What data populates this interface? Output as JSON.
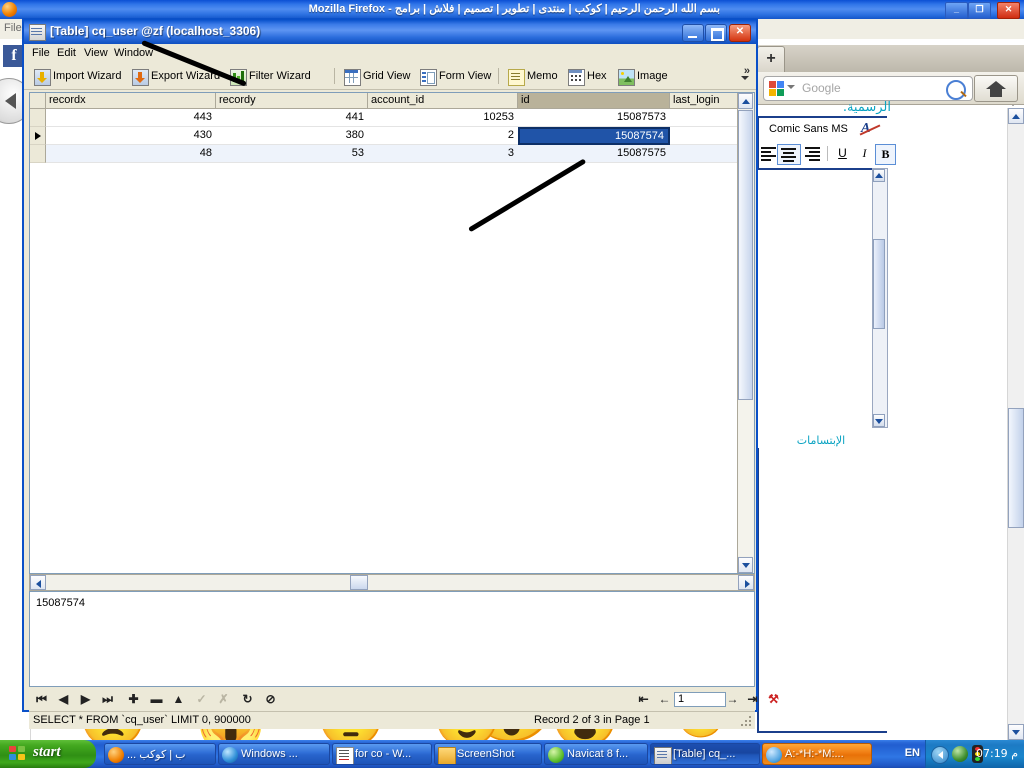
{
  "background_browser": {
    "title": "بسم الله الرحمن الرحيم  |  كوكب  |  منتدى  |  تطوير  |  تصميم  |  فلاش  |  برامج - Mozilla Firefox",
    "menu_file": "File",
    "minimize_label": "_",
    "maximize_label": "❐",
    "close_label": "✕",
    "newtab_label": "+",
    "search": {
      "engine_icon": "google-icon",
      "placeholder": "Google",
      "search_icon": "magnifier-icon"
    },
    "home_icon": "home-icon",
    "facebook_icon": "facebook-icon",
    "back_icon": "back-arrow-icon"
  },
  "page_content": {
    "heading_fragment": "الرسمية.",
    "editor": {
      "font_name": "Comic Sans MS",
      "remove_format_icon": "remove-formatting-icon",
      "align_center_icon": "align-center-icon",
      "align_right_icon": "align-right-icon",
      "underline_label": "U",
      "italic_label": "I",
      "bold_label": "B"
    },
    "smiley_group": {
      "legend": "الإبتسامات",
      "items": [
        {
          "name": "smiley-cap",
          "emoji": "😎"
        },
        {
          "name": "gift-box",
          "emoji": "🎁"
        },
        {
          "name": "smiley-surprised",
          "emoji": "😲"
        }
      ]
    }
  },
  "navicat": {
    "title": "[Table] cq_user @zf (localhost_3306)",
    "window_icon": "table-icon",
    "minimize_label": "_",
    "maximize_label": "❐",
    "close_label": "✕",
    "menus": [
      "File",
      "Edit",
      "View",
      "Window"
    ],
    "toolbar": [
      {
        "label": "Import Wizard",
        "icon": "import-wizard-icon"
      },
      {
        "label": "Export Wizard",
        "icon": "export-wizard-icon"
      },
      {
        "label": "Filter Wizard",
        "icon": "filter-wizard-icon"
      },
      {
        "label": "Grid View",
        "icon": "grid-view-icon"
      },
      {
        "label": "Form View",
        "icon": "form-view-icon"
      },
      {
        "label": "Memo",
        "icon": "memo-icon"
      },
      {
        "label": "Hex",
        "icon": "hex-icon"
      },
      {
        "label": "Image",
        "icon": "image-icon"
      }
    ],
    "toolbar_overflow_label": "»",
    "grid": {
      "columns": [
        "recordx",
        "recordy",
        "account_id",
        "id",
        "last_login"
      ],
      "active_column": "id",
      "rows": [
        {
          "recordx": "443",
          "recordy": "441",
          "account_id": "10253",
          "id": "15087573",
          "last_login": ""
        },
        {
          "recordx": "430",
          "recordy": "380",
          "account_id": "2",
          "id": "15087574",
          "last_login": ""
        },
        {
          "recordx": "48",
          "recordy": "53",
          "account_id": "3",
          "id": "15087575",
          "last_login": ""
        }
      ],
      "selected_row_index": 1,
      "selected_cell_column": "id",
      "selected_cell_value": "15087574"
    },
    "memo_value": "15087574",
    "record_nav": {
      "first_icon": "first-record-icon",
      "prev_icon": "previous-record-icon",
      "next_icon": "next-record-icon",
      "last_icon": "last-record-icon",
      "add_icon": "add-record-icon",
      "delete_icon": "delete-record-icon",
      "edit_icon": "edit-record-icon",
      "apply_icon": "apply-change-icon",
      "cancel_icon": "cancel-change-icon",
      "refresh_icon": "refresh-icon",
      "stop_icon": "stop-icon",
      "page_first_icon": "first-page-icon",
      "page_prev_icon": "previous-page-icon",
      "page_value": "1",
      "page_next_icon": "next-page-icon",
      "page_last_icon": "last-page-icon",
      "page_settings_icon": "page-settings-icon"
    },
    "status": {
      "sql": "SELECT * FROM `cq_user` LIMIT 0, 900000",
      "record_info": "Record 2 of 3 in Page 1"
    }
  },
  "taskbar": {
    "start_label": "start",
    "start_icon": "windows-flag-icon",
    "buttons": [
      {
        "label": "ب | كوكب ...",
        "icon": "firefox-icon",
        "state": "normal"
      },
      {
        "label": "Windows ...",
        "icon": "media-player-icon",
        "state": "normal"
      },
      {
        "label": "for co - W...",
        "icon": "notepad-icon",
        "state": "normal"
      },
      {
        "label": "ScreenShot",
        "icon": "folder-icon",
        "state": "normal"
      },
      {
        "label": "Navicat 8 f...",
        "icon": "navicat-icon",
        "state": "normal"
      },
      {
        "label": "[Table] cq_...",
        "icon": "table-icon",
        "state": "active"
      },
      {
        "label": "A:-*H:-*M:...",
        "icon": "messenger-icon",
        "state": "flashing"
      }
    ],
    "language_indicator": "EN",
    "tray": {
      "show_hidden_icon": "chevron-left-icon",
      "icons": [
        "network-icon",
        "traffic-light-icon"
      ],
      "clock": "07:19 م"
    }
  },
  "colors": {
    "title_blue": "#2f74e8",
    "selection_blue": "#2054a8",
    "window_face": "#ece9d8",
    "taskbar_blue": "#2a68d8",
    "start_green": "#43a81f",
    "flash_orange": "#ef7c12",
    "heading_cyan": "#0aa3c2"
  }
}
